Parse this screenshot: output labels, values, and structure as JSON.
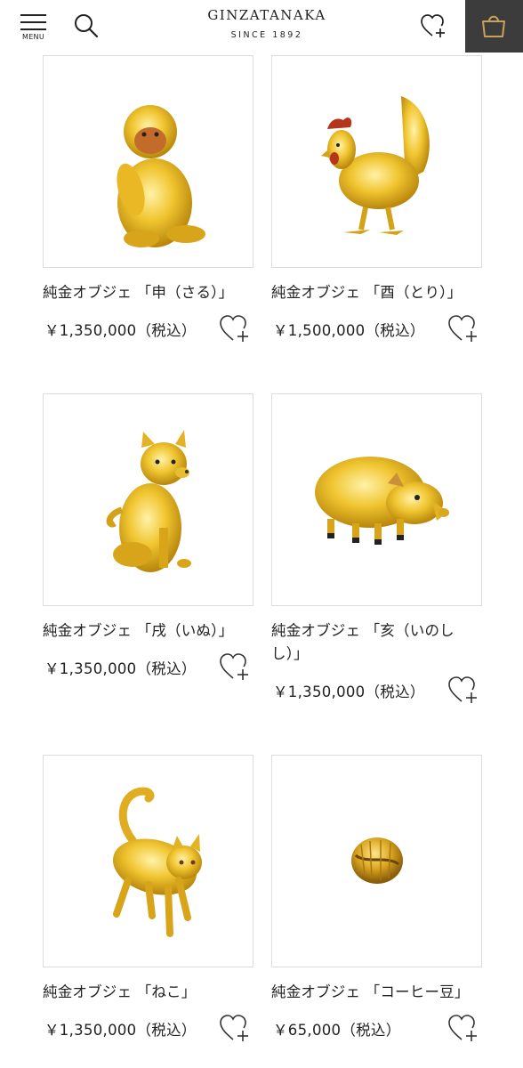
{
  "header": {
    "menu_label": "MENU",
    "brand": "GINZATANAKA",
    "since": "SINCE 1892"
  },
  "colors": {
    "gold": "#e8b81e",
    "cart_bg": "#3c3c3c",
    "cart_icon": "#c9a25a",
    "border": "#dcdcdc"
  },
  "products": [
    {
      "name": "純金オブジェ 「申（さる）」",
      "price": "￥1,350,000（税込）",
      "image": "gold-monkey"
    },
    {
      "name": "純金オブジェ 「酉（とり）」",
      "price": "￥1,500,000（税込）",
      "image": "gold-rooster"
    },
    {
      "name": "純金オブジェ 「戌（いぬ）」",
      "price": "￥1,350,000（税込）",
      "image": "gold-dog"
    },
    {
      "name": "純金オブジェ 「亥（いのしし）」",
      "price": "￥1,350,000（税込）",
      "image": "gold-boar"
    },
    {
      "name": "純金オブジェ 「ねこ」",
      "price": "￥1,350,000（税込）",
      "image": "gold-cat"
    },
    {
      "name": "純金オブジェ 「コーヒー豆」",
      "price": "￥65,000（税込）",
      "image": "gold-coffee-bean"
    }
  ]
}
